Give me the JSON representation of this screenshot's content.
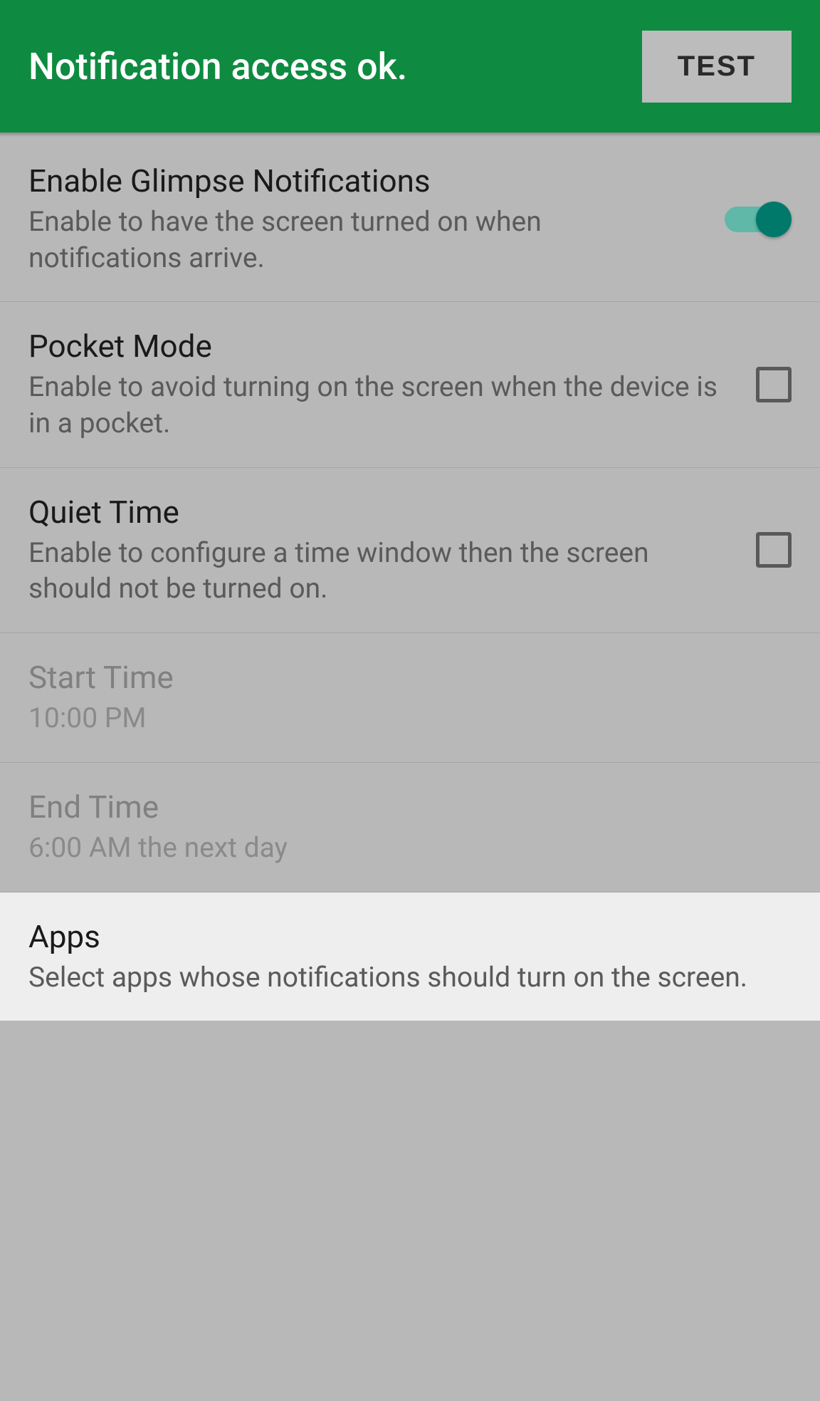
{
  "header": {
    "title": "Notification access ok.",
    "button": "TEST"
  },
  "settings": {
    "enable_glimpse": {
      "title": "Enable Glimpse Notifications",
      "desc": "Enable to have the screen turned on when notifications arrive."
    },
    "pocket_mode": {
      "title": "Pocket Mode",
      "desc": "Enable to avoid turning on the screen when the device is in a pocket."
    },
    "quiet_time": {
      "title": "Quiet Time",
      "desc": "Enable to configure a time window then the screen should not be turned on."
    },
    "start_time": {
      "title": "Start Time",
      "desc": "10:00 PM"
    },
    "end_time": {
      "title": "End Time",
      "desc": "6:00 AM the next day"
    },
    "apps": {
      "title": "Apps",
      "desc": "Select apps whose notifications should turn on the screen."
    }
  }
}
